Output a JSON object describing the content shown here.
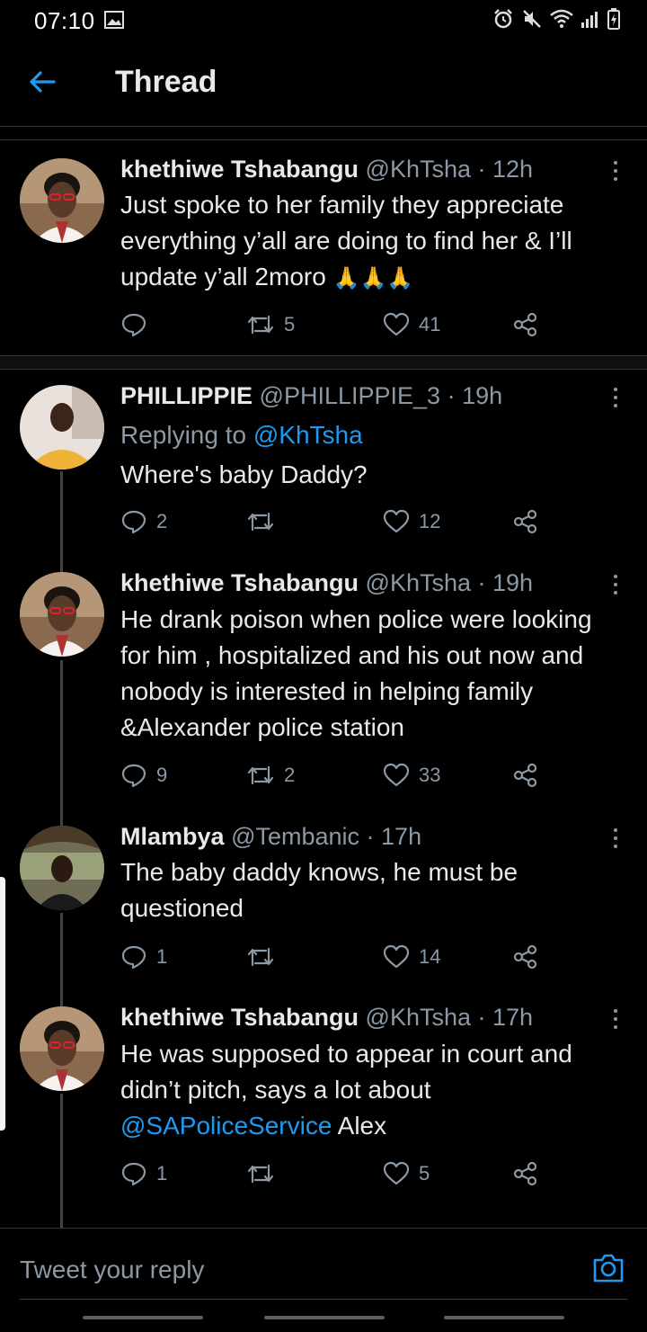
{
  "status_bar": {
    "time": "07:10"
  },
  "header": {
    "title": "Thread"
  },
  "tweets": [
    {
      "name": "khethiwe Tshabangu",
      "handle": "@KhTsha",
      "time": "· 12h",
      "text": "Just spoke to her family they appreciate everything y’all are doing to find her & I’ll update y’all 2moro",
      "emoji": "🙏🙏🙏",
      "replies": "",
      "retweets": "5",
      "likes": "41"
    },
    {
      "name": "PHILLIPPIE",
      "handle": "@PHILLIPPIE_3",
      "time": "· 19h",
      "replying_prefix": "Replying to",
      "replying_to": "@KhTsha",
      "text": "Where's baby Daddy?",
      "replies": "2",
      "retweets": "",
      "likes": "12"
    },
    {
      "name": "khethiwe Tshabangu",
      "handle": "@KhTsha",
      "time": "· 19h",
      "text": "He drank poison when police were looking for him , hospitalized and his out now and nobody is interested in helping family &Alexander police station",
      "replies": "9",
      "retweets": "2",
      "likes": "33"
    },
    {
      "name": "Mlambya",
      "handle": "@Tembanic",
      "time": "· 17h",
      "text": "The baby daddy knows, he must be questioned",
      "replies": "1",
      "retweets": "",
      "likes": "14"
    },
    {
      "name": "khethiwe Tshabangu",
      "handle": "@KhTsha",
      "time": "· 17h",
      "text_pre": "He was supposed to appear in court and didn’t pitch, says a lot about ",
      "mention": "@SAPoliceService",
      "text_post": " Alex",
      "replies": "1",
      "retweets": "",
      "likes": "5"
    }
  ],
  "compose": {
    "placeholder": "Tweet your reply"
  },
  "colors": {
    "accent": "#1d9bf0",
    "muted": "#8b98a5",
    "background": "#000000"
  }
}
